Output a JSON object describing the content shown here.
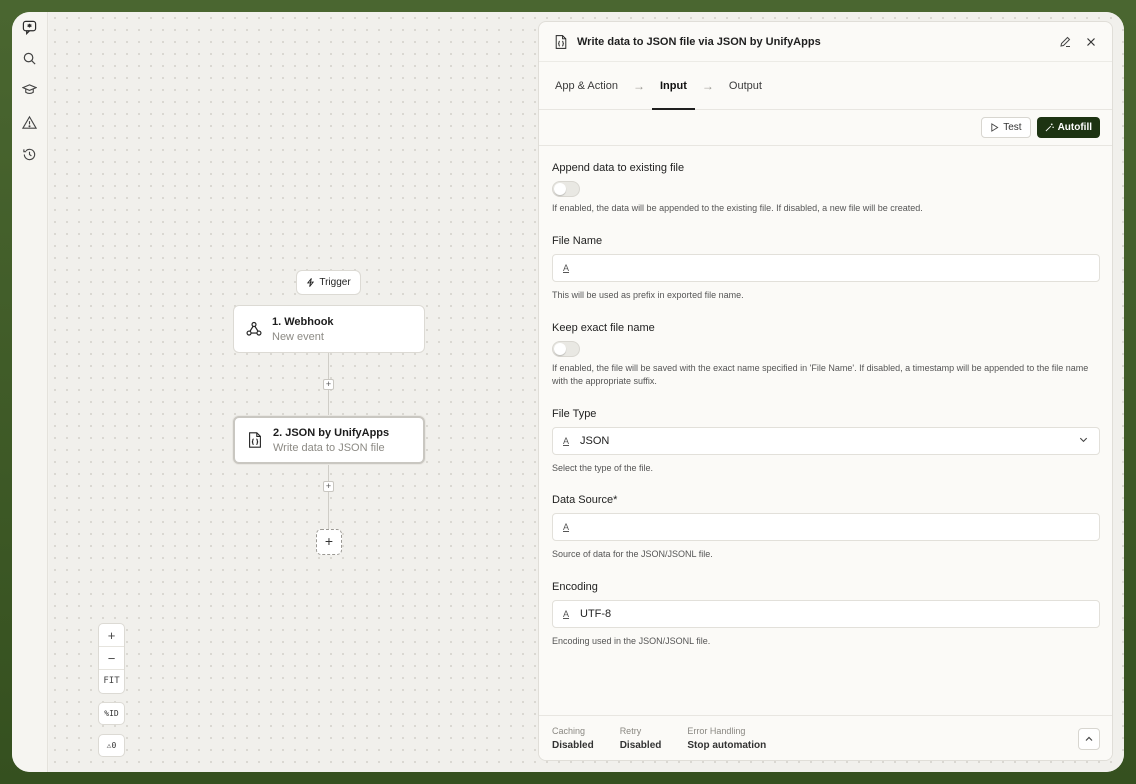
{
  "rail": {
    "icons": [
      "chat-icon",
      "search-icon",
      "graduation-cap-icon",
      "warning-icon",
      "history-icon"
    ]
  },
  "canvas": {
    "trigger_label": "Trigger",
    "nodes": [
      {
        "title": "1. Webhook",
        "subtitle": "New event",
        "icon": "webhook-icon"
      },
      {
        "title": "2. JSON by UnifyApps",
        "subtitle": "Write data to JSON file",
        "icon": "json-file-icon"
      }
    ],
    "zoom": {
      "in": "+",
      "out": "−",
      "fit": "FIT"
    },
    "id_toggle": "%ID",
    "warnings": "⚠0"
  },
  "panel": {
    "title": "Write data to JSON file via JSON by UnifyApps",
    "tabs": [
      {
        "label": "App & Action",
        "active": false
      },
      {
        "label": "Input",
        "active": true
      },
      {
        "label": "Output",
        "active": false
      }
    ],
    "tab_arrow": "→",
    "test_label": "Test",
    "autofill_label": "Autofill",
    "fields": {
      "append": {
        "label": "Append data to existing file",
        "help": "If enabled, the data will be appended to the existing file. If disabled, a new file will be created.",
        "enabled": false
      },
      "file_name": {
        "label": "File Name",
        "value": "",
        "help": "This will be used as prefix in exported file name."
      },
      "keep_exact": {
        "label": "Keep exact file name",
        "help": "If enabled, the file will be saved with the exact name specified in 'File Name'. If disabled, a timestamp will be appended to the file name with the appropriate suffix.",
        "enabled": false
      },
      "file_type": {
        "label": "File Type",
        "value": "JSON",
        "help": "Select the type of the file."
      },
      "data_source": {
        "label": "Data Source*",
        "value": "",
        "help": "Source of data for the JSON/JSONL file."
      },
      "encoding": {
        "label": "Encoding",
        "value": "UTF-8",
        "help": "Encoding used in the JSON/JSONL file."
      }
    },
    "footer": [
      {
        "key": "Caching",
        "value": "Disabled"
      },
      {
        "key": "Retry",
        "value": "Disabled"
      },
      {
        "key": "Error Handling",
        "value": "Stop automation"
      }
    ]
  },
  "colors": {
    "accent": "#1d3312",
    "frame_bg": "#3f5a2b",
    "canvas_bg": "#f1f0ec"
  }
}
